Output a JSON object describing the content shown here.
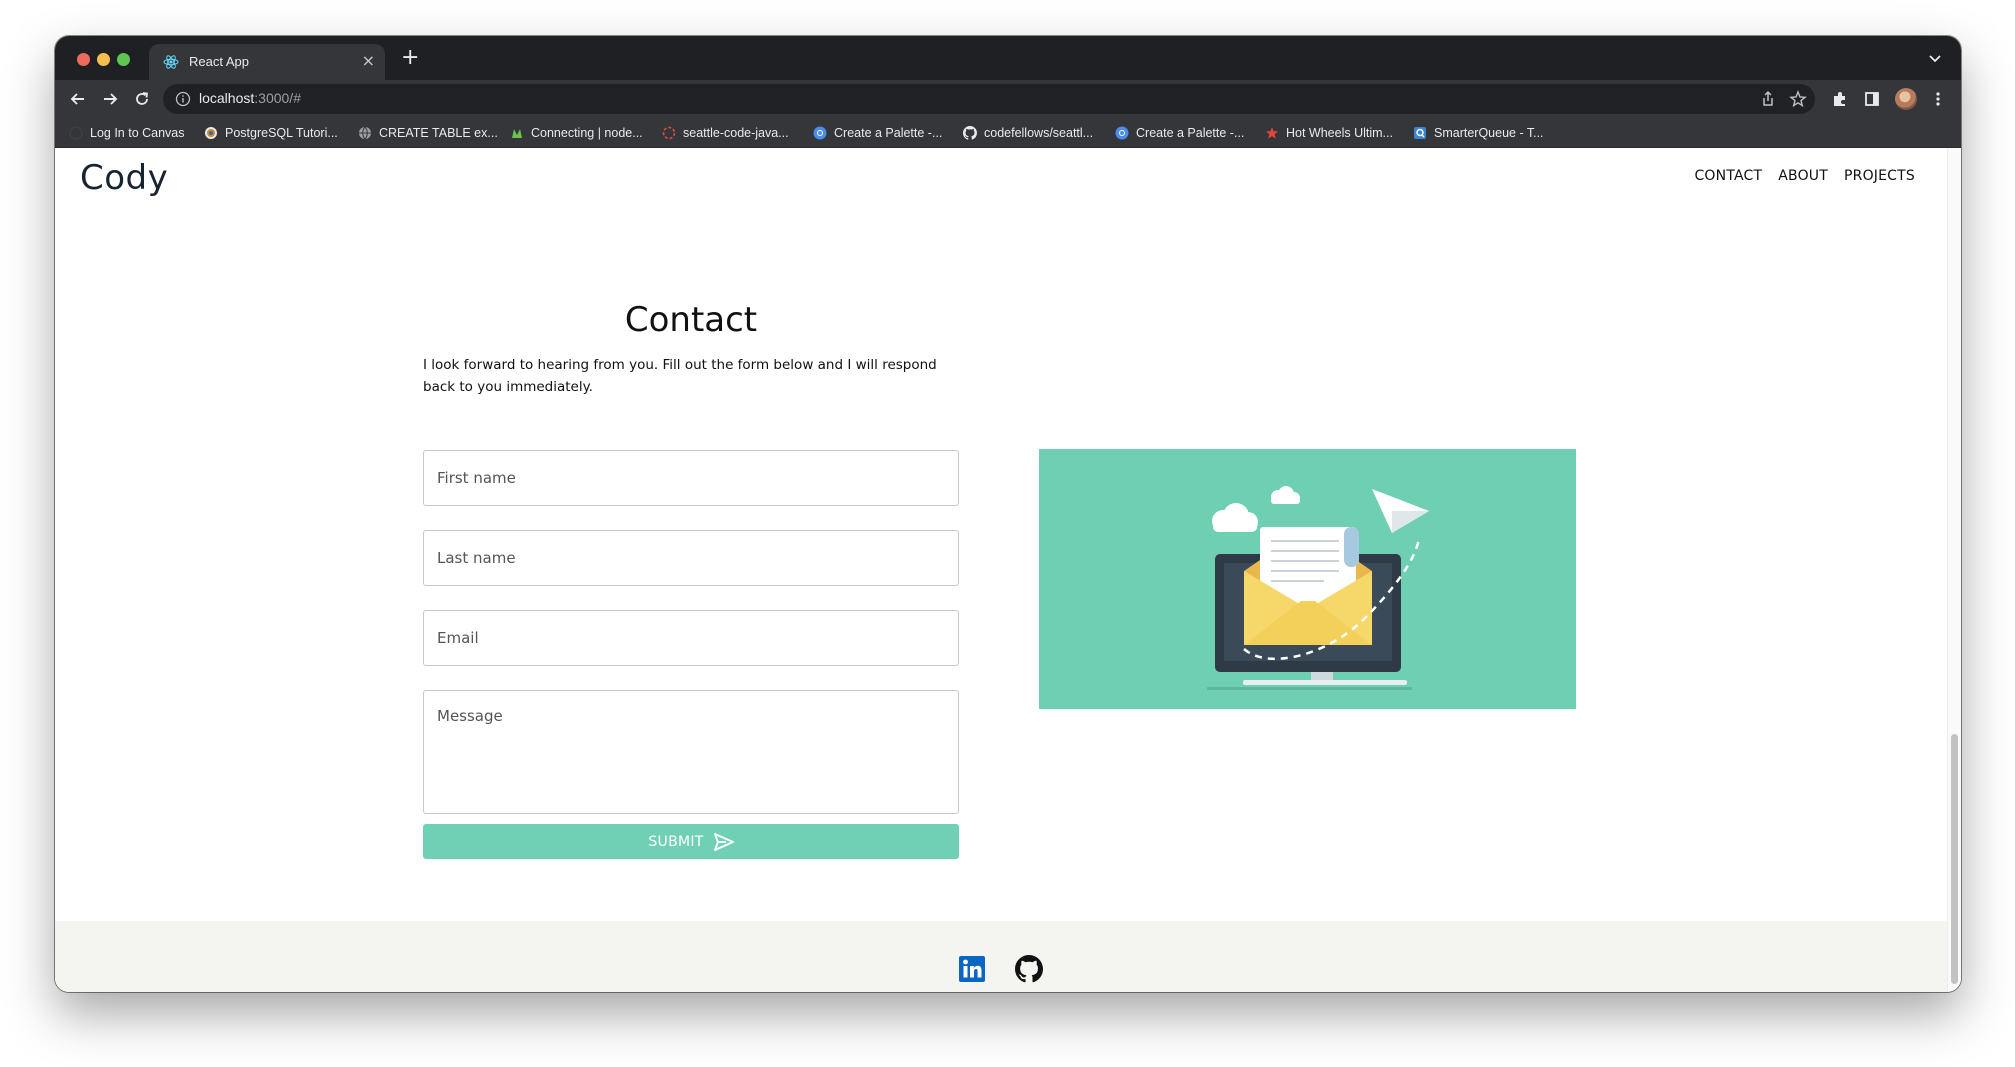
{
  "browser": {
    "tab_title": "React App",
    "new_tab_label": "+",
    "close_label": "×",
    "url_host": "localhost",
    "url_rest": ":3000/#"
  },
  "bookmarks": [
    {
      "label": "Log In to Canvas",
      "icon": "canvas-icon"
    },
    {
      "label": "PostgreSQL Tutori...",
      "icon": "postgres-icon"
    },
    {
      "label": "CREATE TABLE ex...",
      "icon": "globe-icon"
    },
    {
      "label": "Connecting | node...",
      "icon": "node-icon"
    },
    {
      "label": "seattle-code-java...",
      "icon": "circle-dashed-icon"
    },
    {
      "label": "Create a Palette -...",
      "icon": "chrome-icon"
    },
    {
      "label": "codefellows/seattl...",
      "icon": "github-icon"
    },
    {
      "label": "Create a Palette -...",
      "icon": "chrome-icon"
    },
    {
      "label": "Hot Wheels Ultim...",
      "icon": "star-icon"
    },
    {
      "label": "SmarterQueue - T...",
      "icon": "smarterqueue-icon"
    }
  ],
  "site": {
    "brand": "Cody",
    "nav": [
      "CONTACT",
      "ABOUT",
      "PROJECTS"
    ]
  },
  "contact": {
    "title": "Contact",
    "description": "I look forward to hearing from you. Fill out the form below and I will respond back to you immediately.",
    "first_name_placeholder": "First name",
    "last_name_placeholder": "Last name",
    "email_placeholder": "Email",
    "message_placeholder": "Message",
    "submit_label": "SUBMIT"
  },
  "footer": {
    "icons": [
      "linkedin-icon",
      "github-icon"
    ]
  },
  "colors": {
    "accent": "#70d0b6",
    "illustration_bg": "#6ecfb3",
    "footer_bg": "#f4f5f1",
    "linkedin": "#0a66c2"
  }
}
